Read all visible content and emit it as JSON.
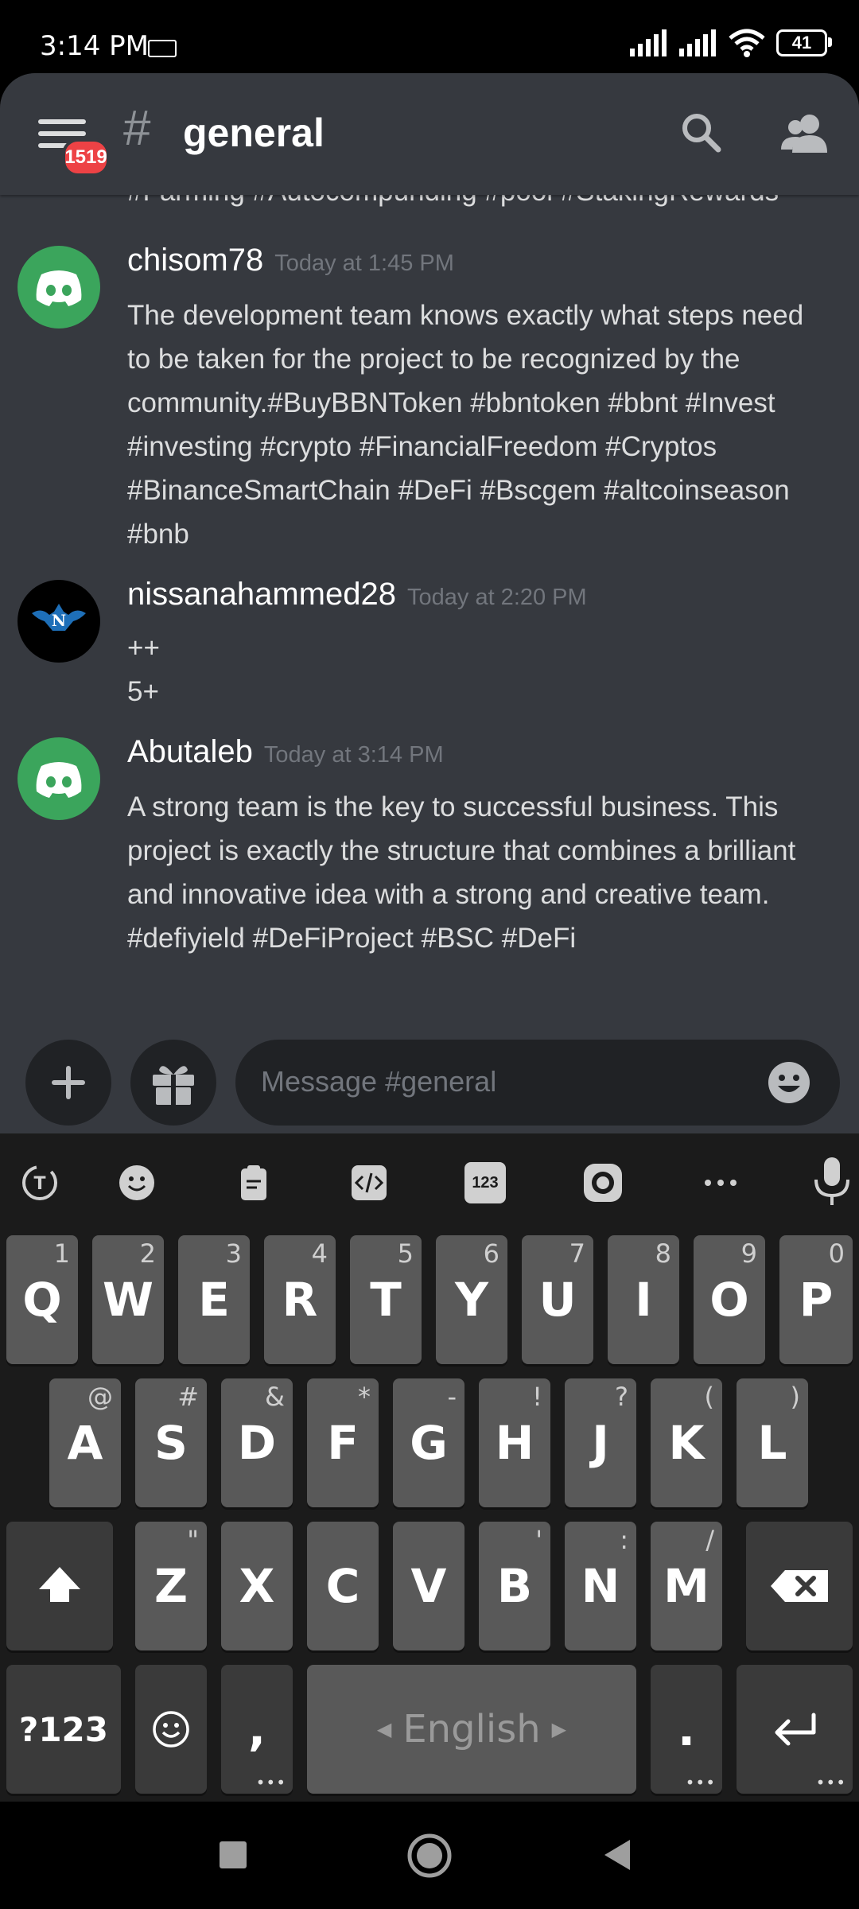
{
  "status_bar": {
    "time": "3:14 PM",
    "battery": "41"
  },
  "header": {
    "badge": "1519",
    "channel": "general"
  },
  "messages": {
    "cut_line": "#Farming #Autocompunding #pool #StakingRewards",
    "items": [
      {
        "username": "chisom78",
        "timestamp": "Today at 1:45 PM",
        "lines": [
          "The development team knows exactly what steps need",
          "to be taken for the project to be recognized by the",
          "community.#BuyBBNToken #bbntoken #bbnt #Invest",
          "#investing #crypto #FinancialFreedom #Cryptos",
          "#BinanceSmartChain #DeFi #Bscgem #altcoinseason",
          "#bnb"
        ]
      },
      {
        "username": "nissanahammed28",
        "timestamp": "Today at 2:20 PM",
        "lines": [
          "++",
          "5+"
        ]
      },
      {
        "username": "Abutaleb",
        "timestamp": "Today at 3:14 PM",
        "lines": [
          "A strong team is the key to successful business. This",
          "project is exactly the structure that combines a brilliant",
          "and innovative idea with a strong and creative team.",
          "#defiyield #DeFiProject #BSC #DeFi"
        ]
      }
    ]
  },
  "composer": {
    "placeholder": "Message #general"
  },
  "keyboard": {
    "row1": [
      {
        "k": "Q",
        "h": "1"
      },
      {
        "k": "W",
        "h": "2"
      },
      {
        "k": "E",
        "h": "3"
      },
      {
        "k": "R",
        "h": "4"
      },
      {
        "k": "T",
        "h": "5"
      },
      {
        "k": "Y",
        "h": "6"
      },
      {
        "k": "U",
        "h": "7"
      },
      {
        "k": "I",
        "h": "8"
      },
      {
        "k": "O",
        "h": "9"
      },
      {
        "k": "P",
        "h": "0"
      }
    ],
    "row2": [
      {
        "k": "A",
        "h": "@"
      },
      {
        "k": "S",
        "h": "#"
      },
      {
        "k": "D",
        "h": "&"
      },
      {
        "k": "F",
        "h": "*"
      },
      {
        "k": "G",
        "h": "-"
      },
      {
        "k": "H",
        "h": "!"
      },
      {
        "k": "J",
        "h": "?"
      },
      {
        "k": "K",
        "h": "("
      },
      {
        "k": "L",
        "h": ")"
      }
    ],
    "row3": [
      {
        "k": "Z",
        "h": "\""
      },
      {
        "k": "X",
        "h": ""
      },
      {
        "k": "C",
        "h": ""
      },
      {
        "k": "V",
        "h": ""
      },
      {
        "k": "B",
        "h": "'"
      },
      {
        "k": "N",
        "h": ":"
      },
      {
        "k": "M",
        "h": "/"
      }
    ],
    "symbols_label": "?123",
    "comma": ",",
    "space_label": "English",
    "period": ".",
    "toolbar_num": "123"
  }
}
